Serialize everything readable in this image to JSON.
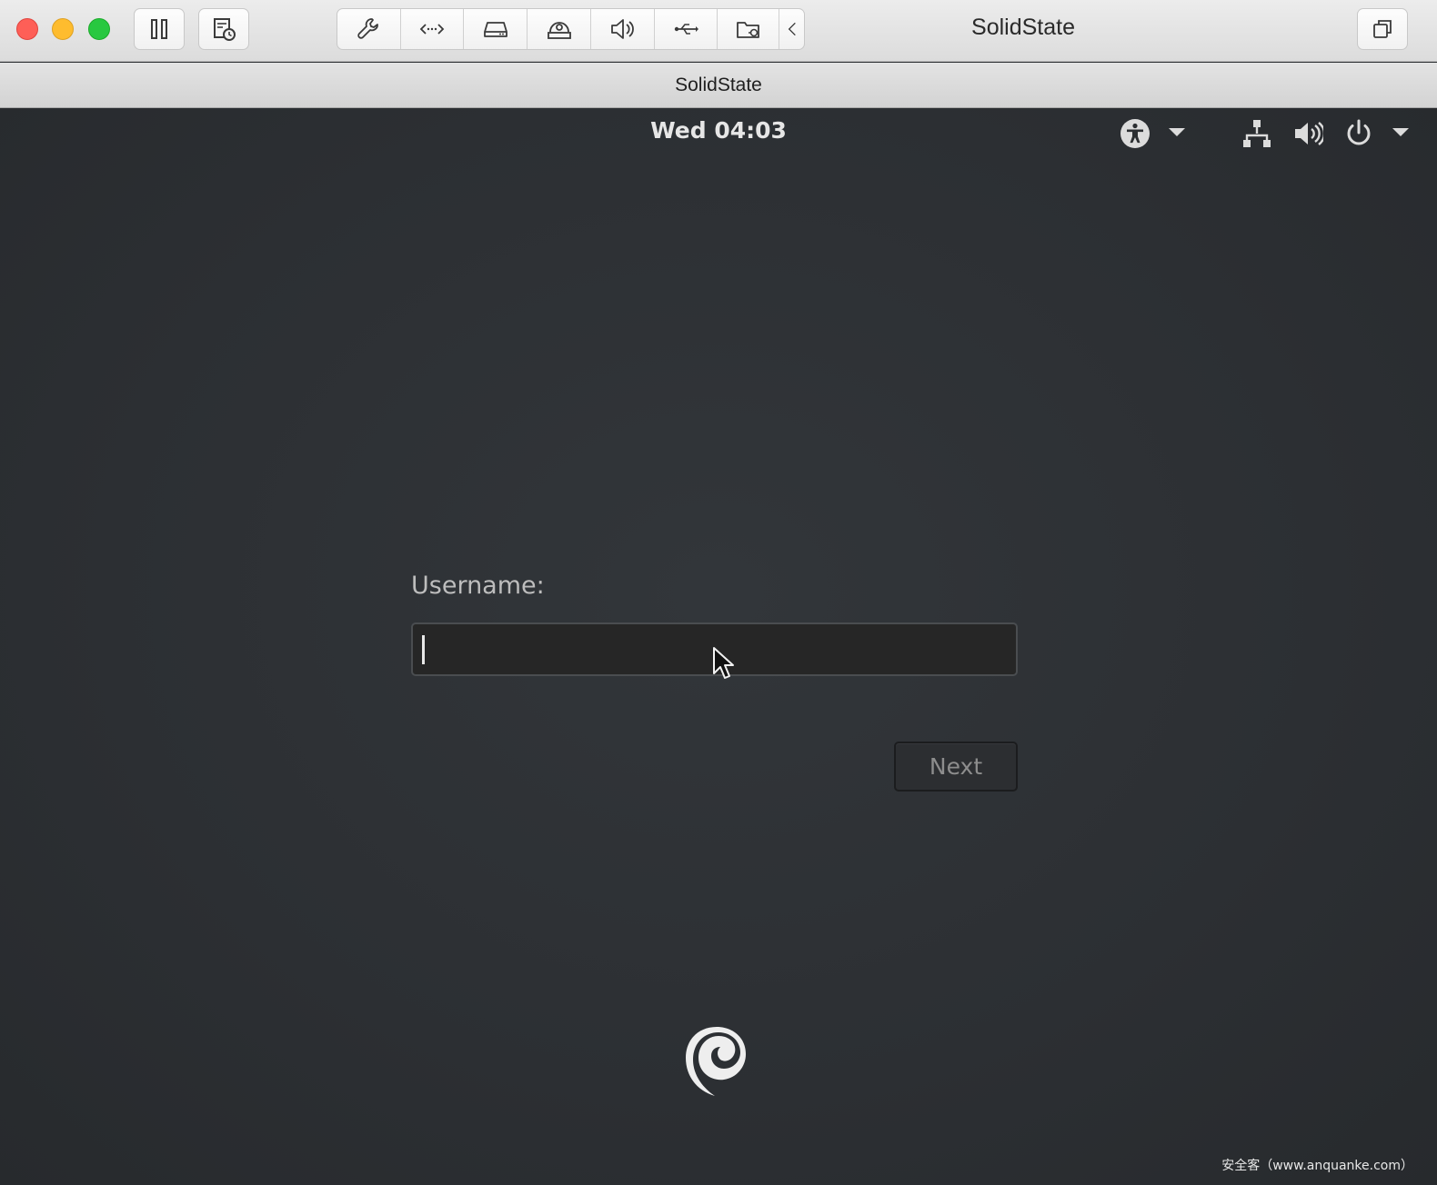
{
  "window": {
    "title": "SolidState",
    "vm_tab_title": "SolidState"
  },
  "toolbar": {
    "left_buttons": [
      "pause-icon",
      "snapshot-icon"
    ],
    "device_buttons": [
      "wrench-icon",
      "network-arrows-icon",
      "hard-disk-icon",
      "optical-drive-icon",
      "speaker-icon",
      "usb-icon",
      "shared-folder-icon",
      "chevron-left-icon"
    ],
    "right_buttons": [
      "window-restore-icon"
    ]
  },
  "guest": {
    "clock": "Wed 04:03",
    "tray_icons": [
      "accessibility-icon",
      "network-icon",
      "volume-icon",
      "power-icon"
    ],
    "login": {
      "username_label": "Username:",
      "username_value": "",
      "next_label": "Next"
    },
    "watermark": "安全客（www.anquanke.com）"
  },
  "colors": {
    "guest_background": "#2b2e31",
    "traffic_red": "#fe5f57",
    "traffic_yellow": "#febc2e",
    "traffic_green": "#28c840"
  }
}
